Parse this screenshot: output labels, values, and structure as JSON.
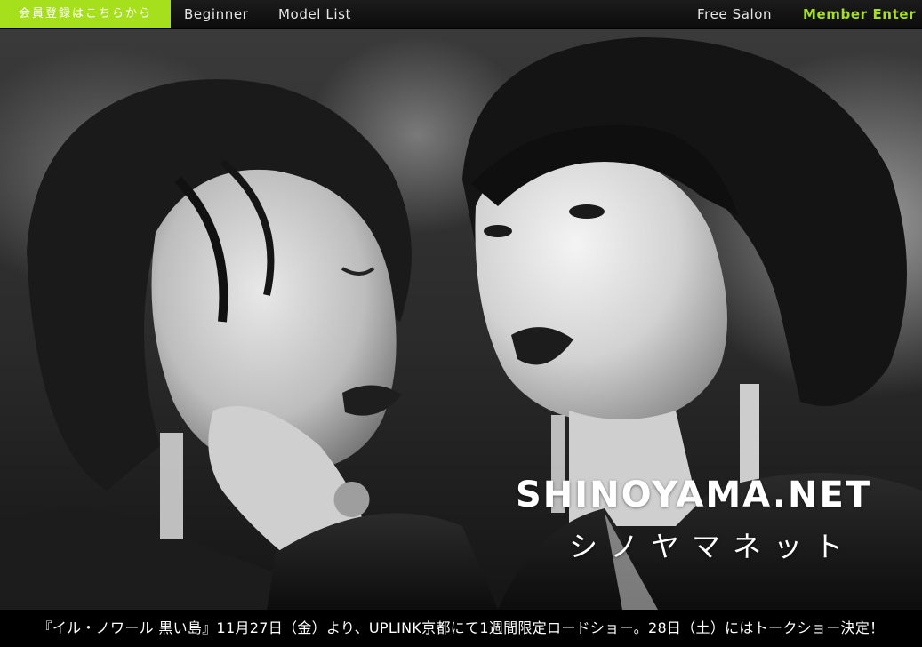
{
  "nav": {
    "signup_label": "会員登録はこちらから",
    "beginner_label": "Beginner",
    "model_list_label": "Model List",
    "free_salon_label": "Free Salon",
    "member_enter_label": "Member Enter"
  },
  "hero": {
    "logo_en": "SHINOYAMA.NET",
    "logo_ja": "シノヤマネット"
  },
  "ticker": {
    "text": "『イル・ノワール 黒い島』11月27日（金）より、UPLINK京都にて1週間限定ロードショー。28日（土）にはトークショー決定！"
  },
  "colors": {
    "accent": "#a6df1b",
    "nav_bg": "#111111",
    "ticker_bg": "#000000"
  }
}
